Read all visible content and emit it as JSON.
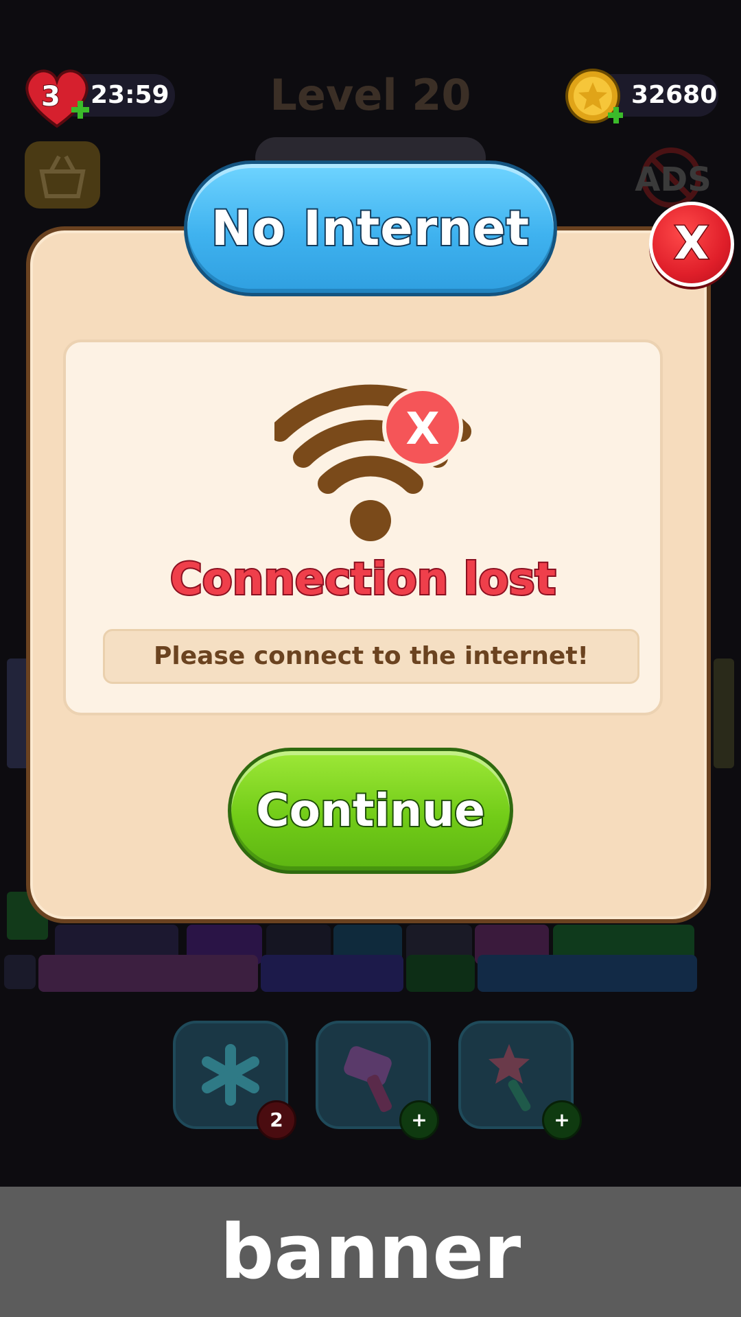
{
  "hud": {
    "lives": "3",
    "life_timer": "23:59",
    "level_title": "Level 20",
    "coins": "32680",
    "ads_label": "ADS"
  },
  "dialog": {
    "title": "No Internet",
    "close_label": "X",
    "wifi_badge": "X",
    "status": "Connection lost",
    "message": "Please connect to the internet!",
    "continue_label": "Continue"
  },
  "boosters": [
    {
      "icon": "snowflake-icon",
      "badge": "2"
    },
    {
      "icon": "hammer-icon",
      "badge": "+"
    },
    {
      "icon": "magic-wand-icon",
      "badge": "+"
    }
  ],
  "banner": {
    "label": "banner"
  },
  "colors": {
    "title_blue": "#3fb2ef",
    "continue_green": "#72cc18",
    "close_red": "#e01f2a",
    "status_red": "#ef3f4b",
    "wifi_brown": "#7a4a1a",
    "panel_cream": "#f6dcbd"
  }
}
